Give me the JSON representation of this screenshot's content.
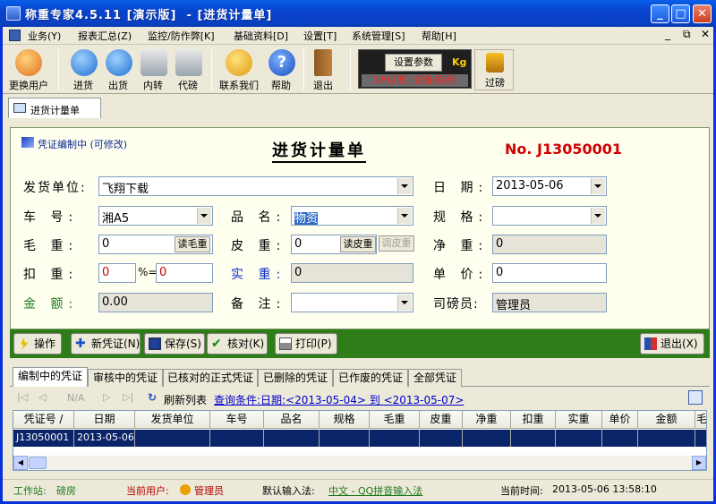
{
  "window": {
    "title": "称重专家4.5.11 [演示版]  - [进货计量单]"
  },
  "menu": [
    "业务(Y)",
    "报表汇总(Z)",
    "监控/防作弊[K]",
    "基础资料[D]",
    "设置[T]",
    "系统管理[S]",
    "帮助[H]"
  ],
  "toolbar": {
    "items": [
      "更换用户",
      "进货",
      "出货",
      "内转",
      "代磅",
      "联系我们",
      "帮助",
      "退出"
    ],
    "set_params": "设置参数",
    "unit": "Kg",
    "meter": "1#仪表 (设备关闭)",
    "weigh_label": "过磅"
  },
  "doc_tab": "进货计量单",
  "form": {
    "status": "凭证编制中 (可修改)",
    "title": "进货计量单",
    "number": "No. J13050001",
    "supplier_label": "发货单位:",
    "supplier_value": "飞翔下载",
    "date_label": "日  期:",
    "date_value": "2013-05-06",
    "car_label": "车  号:",
    "car_value": "湘A5",
    "product_label": "品  名:",
    "product_value": "物资",
    "spec_label": "规  格:",
    "spec_value": "",
    "gross_label": "毛  重:",
    "gross_value": "0",
    "gross_btn": "读毛重",
    "tare_label": "皮  重:",
    "tare_value": "0",
    "tare_btn": "读皮重",
    "tare_adj": "调皮重",
    "net_label": "净  重:",
    "net_value": "0",
    "deduct_label": "扣  重:",
    "deduct_value": "0",
    "pct_label": "%=",
    "deduct_pct": "0",
    "actual_label": "实  重:",
    "actual_value": "0",
    "price_label": "单  价:",
    "price_value": "0",
    "amount_label": "金  额:",
    "amount_value": "0.00",
    "note_label": "备  注:",
    "note_value": "",
    "weigher_label": "司磅员:",
    "weigher_value": "管理员"
  },
  "actions": [
    "操作",
    "新凭证(N)",
    "保存(S)",
    "核对(K)",
    "打印(P)",
    "退出(X)"
  ],
  "tabs": [
    "编制中的凭证",
    "审核中的凭证",
    "已核对的正式凭证",
    "已删除的凭证",
    "已作废的凭证",
    "全部凭证"
  ],
  "nav": {
    "na": "N/A",
    "refresh": "刷新列表",
    "query": "查询条件:日期:<2013-05-04> 到 <2013-05-07>"
  },
  "grid": {
    "columns": [
      "凭证号 /",
      "日期",
      "发货单位",
      "车号",
      "品名",
      "规格",
      "毛重",
      "皮重",
      "净重",
      "扣重",
      "实重",
      "单价",
      "金额",
      "毛"
    ],
    "rows": [
      [
        "J13050001",
        "2013-05-06",
        "",
        "",
        "",
        "",
        "",
        "",
        "",
        "",
        "",
        "",
        "",
        ""
      ]
    ]
  },
  "status": {
    "station_label": "工作站:",
    "station": "磅房",
    "user_label": "当前用户:",
    "user": "管理员",
    "input_label": "默认输入法:",
    "input": "中文 - QQ拼音输入法",
    "time_label": "当前时间:",
    "time": "2013-05-06 13:58:10"
  }
}
